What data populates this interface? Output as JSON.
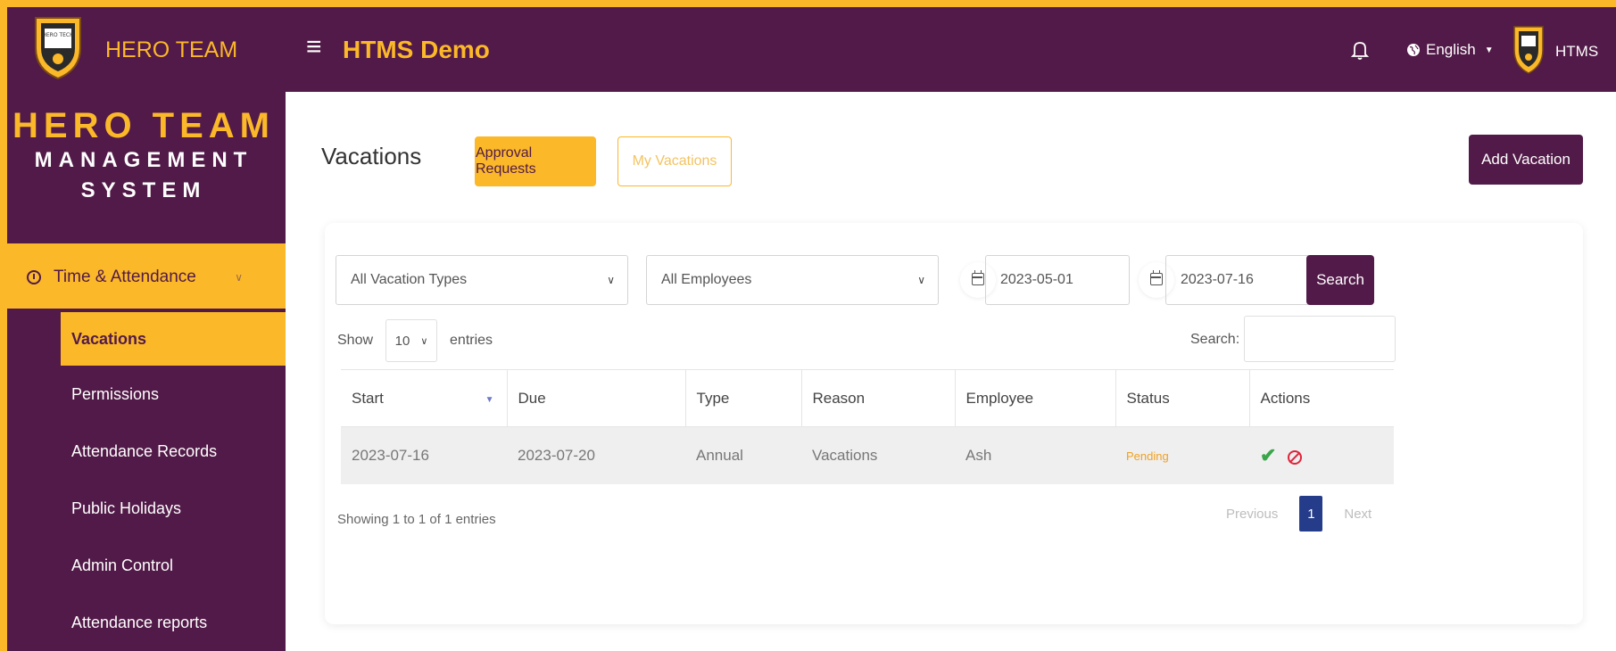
{
  "topbar": {
    "brand": "HERO TEAM",
    "logo_text": "HERO TECH",
    "app_title": "HTMS Demo",
    "language": "English",
    "user": "HTMS"
  },
  "sidebar": {
    "title_line1": "HERO TEAM",
    "title_line2": "MANAGEMENT",
    "title_line3": "SYSTEM",
    "group_label": "Time & Attendance",
    "items": [
      {
        "label": "Vacations"
      },
      {
        "label": "Permissions"
      },
      {
        "label": "Attendance Records"
      },
      {
        "label": "Public Holidays"
      },
      {
        "label": "Admin Control"
      },
      {
        "label": "Attendance reports"
      }
    ]
  },
  "main": {
    "page_title": "Vacations",
    "tabs": [
      {
        "label": "Approval Requests"
      },
      {
        "label": "My Vacations"
      }
    ],
    "add_button": "Add Vacation",
    "filters": {
      "vacation_type": "All Vacation Types",
      "employee": "All Employees",
      "date_from": "2023-05-01",
      "date_to": "2023-07-16",
      "search_button": "Search"
    },
    "table_controls": {
      "show_label": "Show",
      "page_length": "10",
      "entries_label": "entries",
      "search_label": "Search:"
    },
    "table": {
      "headers": [
        "Start",
        "Due",
        "Type",
        "Reason",
        "Employee",
        "Status",
        "Actions"
      ],
      "rows": [
        {
          "start": "2023-07-16",
          "due": "2023-07-20",
          "type": "Annual",
          "reason": "Vacations",
          "employee": "Ash",
          "status": "Pending"
        }
      ]
    },
    "info": "Showing 1 to 1 of 1 entries",
    "pagination": {
      "previous": "Previous",
      "current": "1",
      "next": "Next"
    }
  },
  "colors": {
    "brand_purple": "#521a48",
    "brand_gold": "#fbb829",
    "pager_blue": "#253c8a"
  }
}
